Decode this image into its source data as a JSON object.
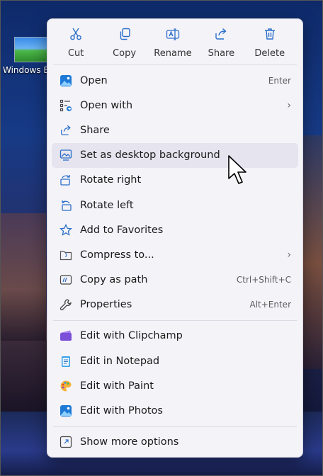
{
  "desktop": {
    "icon_label": "Windows B"
  },
  "toolbar": [
    {
      "label": "Cut",
      "icon": "scissors-icon"
    },
    {
      "label": "Copy",
      "icon": "copy-icon"
    },
    {
      "label": "Rename",
      "icon": "rename-icon"
    },
    {
      "label": "Share",
      "icon": "share-icon"
    },
    {
      "label": "Delete",
      "icon": "trash-icon"
    }
  ],
  "menu_group_1": [
    {
      "label": "Open",
      "shortcut": "Enter",
      "icon": "photos-icon"
    },
    {
      "label": "Open with",
      "shortcut": "",
      "submenu": true,
      "icon": "open-with-icon"
    },
    {
      "label": "Share",
      "shortcut": "",
      "icon": "share-icon"
    },
    {
      "label": "Set as desktop background",
      "shortcut": "",
      "icon": "desktop-background-icon",
      "highlighted": true
    },
    {
      "label": "Rotate right",
      "shortcut": "",
      "icon": "rotate-right-icon"
    },
    {
      "label": "Rotate left",
      "shortcut": "",
      "icon": "rotate-left-icon"
    },
    {
      "label": "Add to Favorites",
      "shortcut": "",
      "icon": "star-icon"
    },
    {
      "label": "Compress to...",
      "shortcut": "",
      "submenu": true,
      "icon": "zip-folder-icon"
    },
    {
      "label": "Copy as path",
      "shortcut": "Ctrl+Shift+C",
      "icon": "copy-path-icon"
    },
    {
      "label": "Properties",
      "shortcut": "Alt+Enter",
      "icon": "wrench-icon"
    }
  ],
  "menu_group_2": [
    {
      "label": "Edit with Clipchamp",
      "icon": "clipchamp-icon"
    },
    {
      "label": "Edit in Notepad",
      "icon": "notepad-icon"
    },
    {
      "label": "Edit with Paint",
      "icon": "paint-icon"
    },
    {
      "label": "Edit with Photos",
      "icon": "photos-icon"
    }
  ],
  "menu_group_3": [
    {
      "label": "Show more options",
      "icon": "show-more-icon"
    }
  ],
  "colors": {
    "accent": "#2b6fc9",
    "menu_bg": "#f4f3f8",
    "hover_bg": "#e6e4ee"
  }
}
